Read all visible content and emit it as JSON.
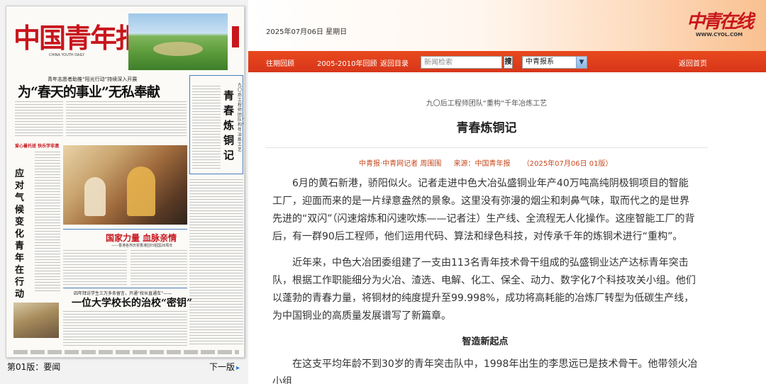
{
  "newspaper": {
    "masthead": "中国青年报",
    "masthead_sub": "CHINA YOUTH DAILY",
    "kicker": "青年志愿者助推“阳光行动”持续深入开展",
    "headline": "为“春天的事业”无私奉献",
    "feature_vertical_title": "青春炼铜记",
    "feature_vertical_sub": "九〇后工程师团队“重构”千年冶炼工艺",
    "red_tag": "爱心暑托班 快乐学非遗",
    "side_vertical_title": "应对气候变化 青年在行动",
    "mid_headline": "国家力量 血脉亲情",
    "mid_sub": "——香港各界庆祝香港回归祖国28周年",
    "kicker2": "四年拜访学生三万多条留言，开通“校长直通车”——",
    "headline2": "一位大学校长的治校“密钥”"
  },
  "footer": {
    "page_label": "第01版：要闻",
    "next_page": "下一版",
    "next_icon": "▸"
  },
  "header": {
    "date": "2025年07月06日 星期日",
    "brand_mark": "中青在线",
    "brand_url": "WWW.CYOL.COM"
  },
  "nav": {
    "past_review": "往期回顾",
    "archive_review": "2005-2010年回顾",
    "back_to_index": "返回目录",
    "search_placeholder": "新闻检索",
    "search_button": "搜",
    "paper_select": "中青报系",
    "back_home": "返回首页"
  },
  "article": {
    "sub_title": "九〇后工程师团队“重构”千年冶炼工艺",
    "title": "青春炼铜记",
    "author": "中青报·中青网记者 周围围",
    "source": "来源：中国青年报",
    "edition": "（2025年07月06日 01版）",
    "paragraphs": [
      "6月的黄石新港，骄阳似火。记者走进中色大冶弘盛铜业年产40万吨高纯阴极铜项目的智能工厂，迎面而来的是一片绿意盎然的景象。这里没有弥漫的烟尘和刺鼻气味，取而代之的是世界先进的“双闪”（闪速熔炼和闪速吹炼——记者注）生产线、全流程无人化操作。这座智能工厂的背后，有一群90后工程师，他们运用代码、算法和绿色科技，对传承千年的炼铜术进行“重构”。",
      "近年来，中色大冶团委组建了一支由113名青年技术骨干组成的弘盛铜业达产达标青年突击队，根据工作职能细分为火冶、渣选、电解、化工、保全、动力、数字化7个科技攻关小组。他们以蓬勃的青春力量，将铜材的纯度提升至99.998%，成功将高耗能的冶炼厂转型为低碳生产线，为中国铜业的高质量发展谱写了新篇章。"
    ],
    "section_head": "智造新起点",
    "paragraph_last": "在这支平均年龄不到30岁的青年突击队中，1998年出生的李思远已是技术骨干。他带领火冶小组"
  }
}
